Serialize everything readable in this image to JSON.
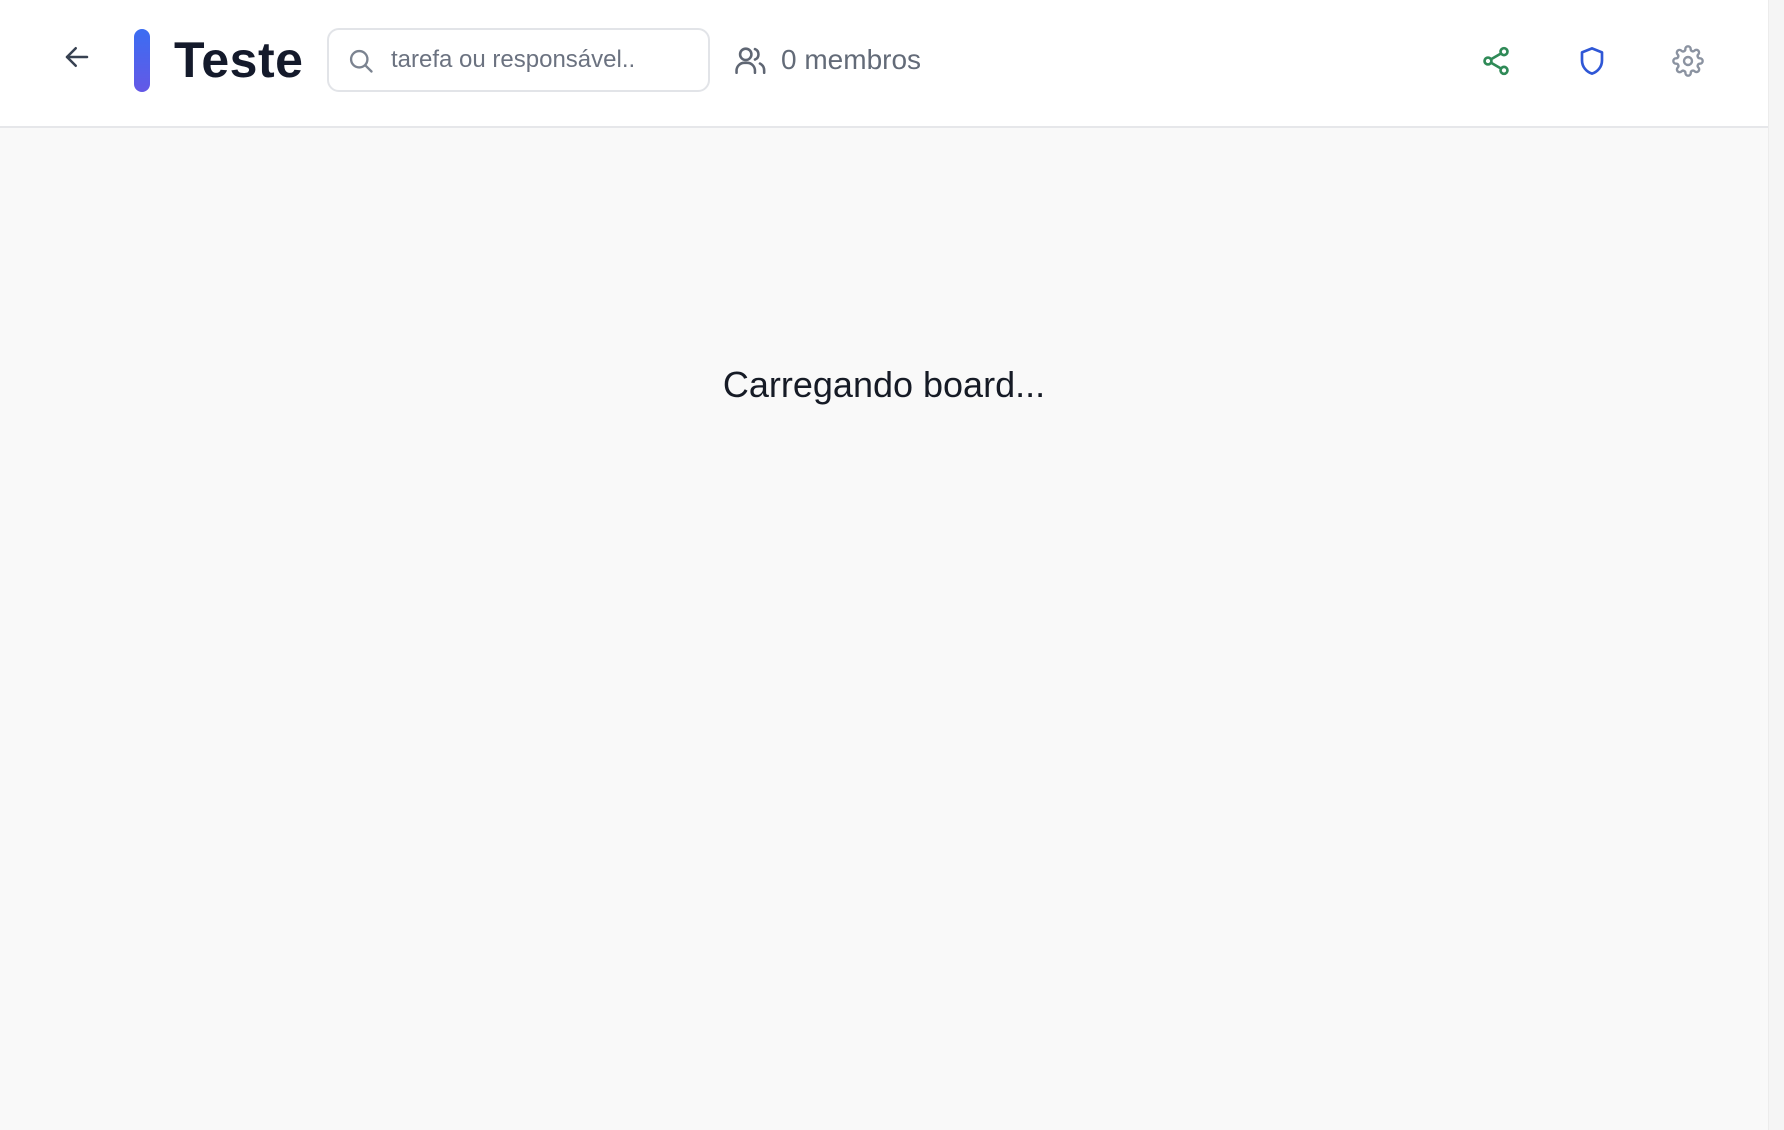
{
  "header": {
    "back_icon": "arrow-left-icon",
    "title": "Teste",
    "title_bar_colors": [
      "#3b6df2",
      "#6458e6"
    ],
    "search": {
      "placeholder": "tarefa ou responsável..",
      "value": "",
      "icon": "search-icon"
    },
    "members": {
      "icon": "users-icon",
      "label": "0 membros"
    },
    "actions": {
      "share": {
        "icon": "share-icon",
        "color": "#2f8a57"
      },
      "permissions": {
        "icon": "shield-icon",
        "color": "#2f57d6"
      },
      "settings": {
        "icon": "gear-icon",
        "color": "#8b93a1"
      }
    }
  },
  "main": {
    "loading_text": "Carregando board..."
  }
}
